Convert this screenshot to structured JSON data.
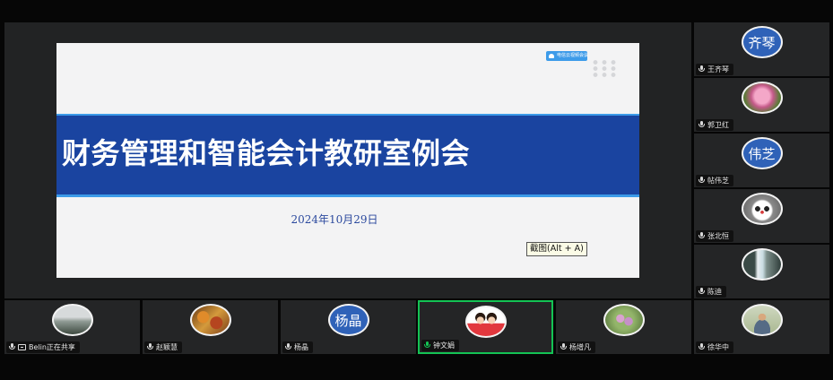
{
  "slide": {
    "logo_text": "电信云视频会议",
    "title": "财务管理和智能会计教研室例会",
    "date": "2024年10月29日",
    "screenshot_hint": "截图(Alt + A)"
  },
  "sidebar_participants": [
    {
      "name": "王齐琴",
      "avatar_text": "齐琴",
      "avatar_kind": "text"
    },
    {
      "name": "郭卫红",
      "avatar_text": "",
      "avatar_kind": "flower-photo"
    },
    {
      "name": "帖伟芝",
      "avatar_text": "伟芝",
      "avatar_kind": "text"
    },
    {
      "name": "张北恒",
      "avatar_text": "",
      "avatar_kind": "panda-photo"
    },
    {
      "name": "陈迪",
      "avatar_text": "",
      "avatar_kind": "waterfall-photo"
    },
    {
      "name": "徐华中",
      "avatar_text": "",
      "avatar_kind": "person-photo"
    }
  ],
  "bottom_participants": [
    {
      "name": "Belin正在共享",
      "avatar_text": "",
      "avatar_kind": "mist-photo",
      "sharing": true
    },
    {
      "name": "赵颖慧",
      "avatar_text": "",
      "avatar_kind": "autumn-photo"
    },
    {
      "name": "杨晶",
      "avatar_text": "杨晶",
      "avatar_kind": "text"
    },
    {
      "name": "钟文娟",
      "avatar_text": "",
      "avatar_kind": "kids-photo",
      "speaking": true
    },
    {
      "name": "杨增凡",
      "avatar_text": "",
      "avatar_kind": "flower-photo"
    }
  ],
  "colors": {
    "active_speaker_border": "#14c354",
    "slide_band": "#1a44a0",
    "avatar_text_bg": "#2f62b8"
  }
}
